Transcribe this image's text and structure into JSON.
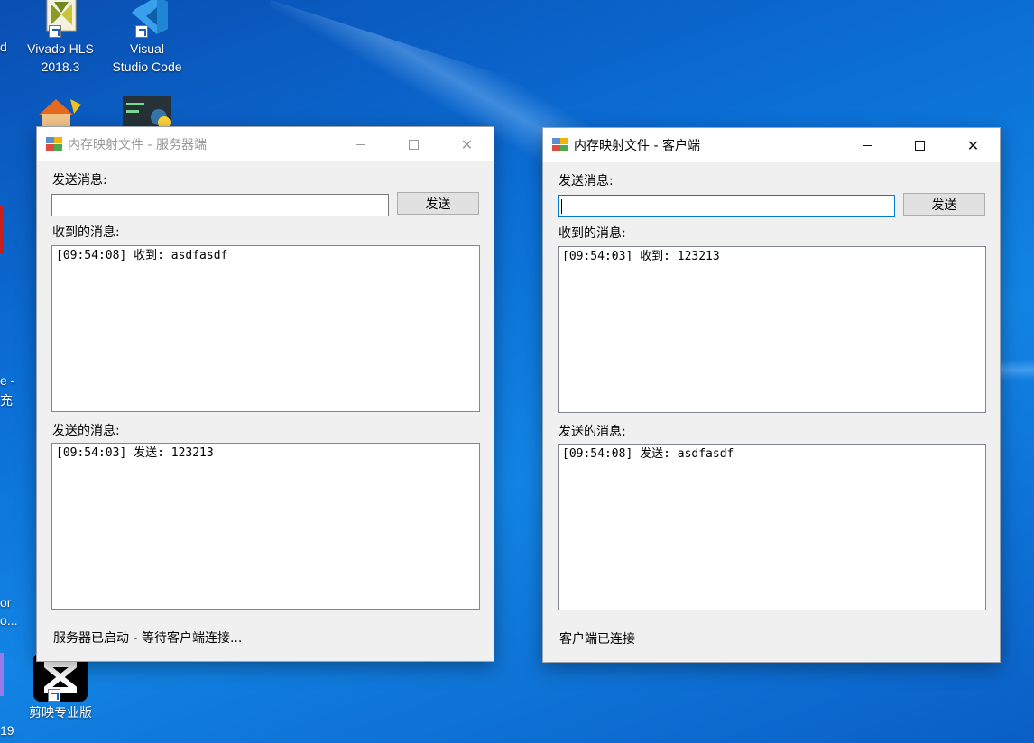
{
  "desktop": {
    "icons": [
      {
        "label_line1": "Vivado HLS",
        "label_line2": "2018.3"
      },
      {
        "label_line1": "Visual",
        "label_line2": "Studio Code"
      },
      {
        "label_line1": "剪映专业版"
      }
    ],
    "partial_labels": [
      "d",
      "e -",
      "充",
      "or",
      "o...",
      "19"
    ]
  },
  "server_window": {
    "title": "内存映射文件 - 服务器端",
    "send_label": "发送消息:",
    "send_input_value": "",
    "send_button": "发送",
    "received_label": "收到的消息:",
    "received_items": [
      "[09:54:08] 收到: asdfasdf"
    ],
    "sent_label": "发送的消息:",
    "sent_items": [
      "[09:54:03] 发送: 123213"
    ],
    "status": "服务器已启动 - 等待客户端连接..."
  },
  "client_window": {
    "title": "内存映射文件 - 客户端",
    "send_label": "发送消息:",
    "send_input_value": "",
    "send_button": "发送",
    "received_label": "收到的消息:",
    "received_items": [
      "[09:54:03] 收到: 123213"
    ],
    "sent_label": "发送的消息:",
    "sent_items": [
      "[09:54:08] 发送: asdfasdf"
    ],
    "status": "客户端已连接"
  },
  "titlebar_buttons": {
    "minimize": "minimize",
    "maximize": "maximize",
    "close": "✕"
  }
}
